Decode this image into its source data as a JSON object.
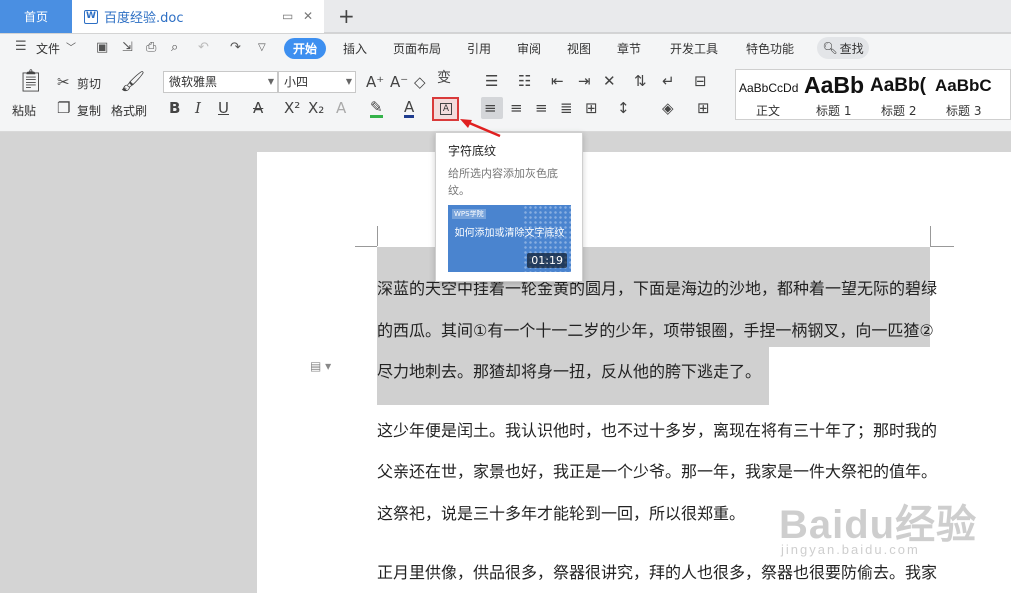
{
  "tabbar": {
    "home": "首页",
    "doc_title": "百度经验.doc",
    "doc_icon": "W",
    "new_tab": "+"
  },
  "menu": {
    "file": "文件",
    "items": [
      "开始",
      "插入",
      "页面布局",
      "引用",
      "审阅",
      "视图",
      "章节",
      "开发工具",
      "特色功能"
    ],
    "find": "查找"
  },
  "ribbon": {
    "paste": "粘贴",
    "cut": "剪切",
    "copy": "复制",
    "format_painter": "格式刷",
    "font_name": "微软雅黑",
    "font_size": "小四",
    "styles": [
      {
        "preview": "AaBbCcDd",
        "label": "正文"
      },
      {
        "preview": "AaBb",
        "label": "标题 1"
      },
      {
        "preview": "AaBb(",
        "label": "标题 2"
      },
      {
        "preview": "AaBbC",
        "label": "标题 3"
      }
    ]
  },
  "tooltip": {
    "title": "字符底纹",
    "description": "给所选内容添加灰色底纹。",
    "video_brand": "WPS学院",
    "video_title": "如何添加或清除文字底纹",
    "video_duration": "01:19"
  },
  "document": {
    "lines": [
      "深蓝的天空中挂着一轮金黄的圆月，下面是海边的沙地，都种着一望无际的碧绿",
      "的西瓜。其间①有一个十一二岁的少年，项带银圈，手捏一柄钢叉，向一匹猹②",
      "尽力地刺去。那猹却将身一扭，反从他的胯下逃走了。",
      "这少年便是闰土。我认识他时，也不过十多岁，离现在将有三十年了；那时我的",
      "父亲还在世，家景也好，我正是一个少爷。那一年，我家是一件大祭祀的值年。",
      "这祭祀，说是三十多年才能轮到一回，所以很郑重。",
      "正月里供像，供品很多，祭器很讲究，拜的人也很多，祭器也很要防偷去。我家"
    ]
  },
  "watermark": {
    "brand": "Baidu经验",
    "url": "jingyan.baidu.com"
  }
}
